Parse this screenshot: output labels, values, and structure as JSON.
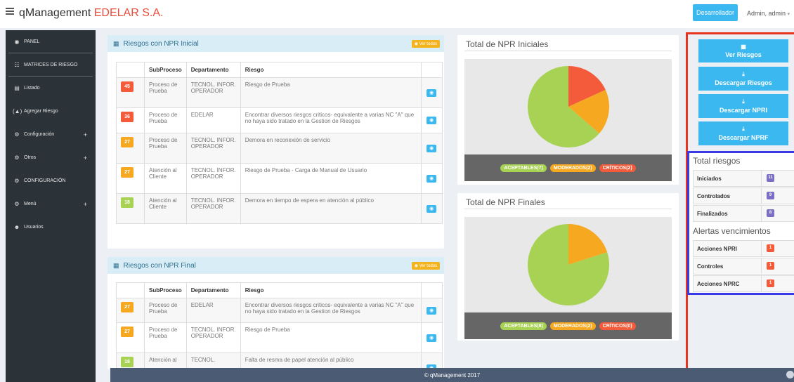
{
  "app": {
    "name": "qManagement",
    "company": "EDELAR S.A."
  },
  "header": {
    "env_button": "Desarrollador",
    "user": "Admin, admin"
  },
  "sidebar": {
    "items": [
      {
        "icon": "dashboard-icon",
        "glyph": "◉",
        "label": "PANEL"
      },
      {
        "icon": "grid-icon",
        "glyph": "☷",
        "label": "MATRICES DE RIESGO"
      },
      {
        "icon": "table-icon",
        "glyph": "▤",
        "label": "Listado"
      },
      {
        "icon": "upload-icon",
        "glyph": "(▲)",
        "label": "Agregar Riesgo"
      },
      {
        "icon": "cogs-icon",
        "glyph": "⚙",
        "label": "Configuración",
        "plus": "+"
      },
      {
        "icon": "cogs-icon",
        "glyph": "⚙",
        "label": "Otros",
        "plus": "+"
      },
      {
        "icon": "cogs-icon",
        "glyph": "⚙",
        "label": "CONFIGURACIÓN"
      },
      {
        "icon": "cogs-icon",
        "glyph": "⚙",
        "label": "Menú",
        "plus": "+"
      },
      {
        "icon": "users-icon",
        "glyph": "☻",
        "label": "Usuarios"
      }
    ]
  },
  "npr_inicial": {
    "title": "Riesgos con NPR Inicial",
    "ver_todos": "◉ Ver todos",
    "columns": [
      "",
      "SubProceso",
      "Departamento",
      "Riesgo",
      ""
    ],
    "rows": [
      {
        "score": "45",
        "color": "red",
        "subproceso": "Proceso de Prueba",
        "departamento": "TECNOL. INFOR. OPERADOR",
        "riesgo": "Riesgo de Prueba"
      },
      {
        "score": "36",
        "color": "red",
        "subproceso": "Proceso de Prueba",
        "departamento": "EDELAR",
        "riesgo": "Encontrar diversos riesgos criticos- equivalente a varias NC \"A\" que no haya sido tratado en la Gestion de Riesgos"
      },
      {
        "score": "27",
        "color": "orange",
        "subproceso": "Proceso de Prueba",
        "departamento": "TECNOL. INFOR. OPERADOR",
        "riesgo": "Demora en reconexión de servicio"
      },
      {
        "score": "27",
        "color": "orange",
        "subproceso": "Atención al Cliente",
        "departamento": "TECNOL. INFOR. OPERADOR",
        "riesgo": "Riesgo de Prueba - Carga de Manual de Usuario"
      },
      {
        "score": "18",
        "color": "green",
        "subproceso": "Atención al Cliente",
        "departamento": "TECNOL. INFOR. OPERADOR",
        "riesgo": "Demora en tiempo de espera en atención al público"
      }
    ]
  },
  "npr_final": {
    "title": "Riesgos con NPR Final",
    "ver_todos": "◉ Ver todos",
    "columns": [
      "",
      "SubProceso",
      "Departamento",
      "Riesgo",
      ""
    ],
    "rows": [
      {
        "score": "27",
        "color": "orange",
        "subproceso": "Proceso de Prueba",
        "departamento": "EDELAR",
        "riesgo": "Encontrar diversos riesgos criticos- equivalente a varias NC \"A\" que no haya sido tratado en la Gestion de Riesgos"
      },
      {
        "score": "27",
        "color": "orange",
        "subproceso": "Proceso de Prueba",
        "departamento": "TECNOL. INFOR. OPERADOR",
        "riesgo": "Riesgo de Prueba"
      },
      {
        "score": "18",
        "color": "green",
        "subproceso": "Atención al",
        "departamento": "TECNOL.",
        "riesgo": "Falta de resma de papel atención al público"
      }
    ]
  },
  "chart_data": [
    {
      "type": "pie",
      "title": "Total de NPR Iniciales",
      "labels": [
        "ACEPTABLES",
        "MODERADOS",
        "CRÍTICOS"
      ],
      "values": [
        7,
        2,
        2
      ],
      "legend": [
        "ACEPTABLES(7)",
        "MODERADOS(2)",
        "CRÍTICOS(2)"
      ],
      "colors": [
        "#a7d253",
        "#f6a820",
        "#f45b3b"
      ]
    },
    {
      "type": "pie",
      "title": "Total de NPR Finales",
      "labels": [
        "ACEPTABLES",
        "MODERADOS",
        "CRÍTICOS"
      ],
      "values": [
        8,
        2,
        0
      ],
      "legend": [
        "ACEPTABLES(8)",
        "MODERADOS(2)",
        "CRÍTICOS(0)"
      ],
      "colors": [
        "#a7d253",
        "#f6a820",
        "#f45b3b"
      ]
    }
  ],
  "actions": [
    {
      "icon": "table-icon",
      "glyph": "▦",
      "label": "Ver Riesgos"
    },
    {
      "icon": "download-icon",
      "glyph": "⤓",
      "label": "Descargar Riesgos"
    },
    {
      "icon": "download-icon",
      "glyph": "⤓",
      "label": "Descargar NPRI"
    },
    {
      "icon": "download-icon",
      "glyph": "⤓",
      "label": "Descargar NPRF"
    }
  ],
  "totals": {
    "title": "Total riesgos",
    "rows": [
      {
        "label": "Iniciados",
        "value": "11"
      },
      {
        "label": "Controlados",
        "value": "9"
      },
      {
        "label": "Finalizados",
        "value": "8"
      }
    ]
  },
  "alerts": {
    "title": "Alertas vencimientos",
    "rows": [
      {
        "label": "Acciones NPRI",
        "value": "1"
      },
      {
        "label": "Controles",
        "value": "1"
      },
      {
        "label": "Acciones NPRC",
        "value": "1"
      }
    ]
  },
  "footer": {
    "text": "© qManagement 2017"
  },
  "colors": {
    "accent": "#3cb8f0",
    "sidebar": "#2c3338",
    "brand_red": "#e74c3c",
    "highlight_red": "#e8341c",
    "highlight_blue": "#3939e6"
  }
}
